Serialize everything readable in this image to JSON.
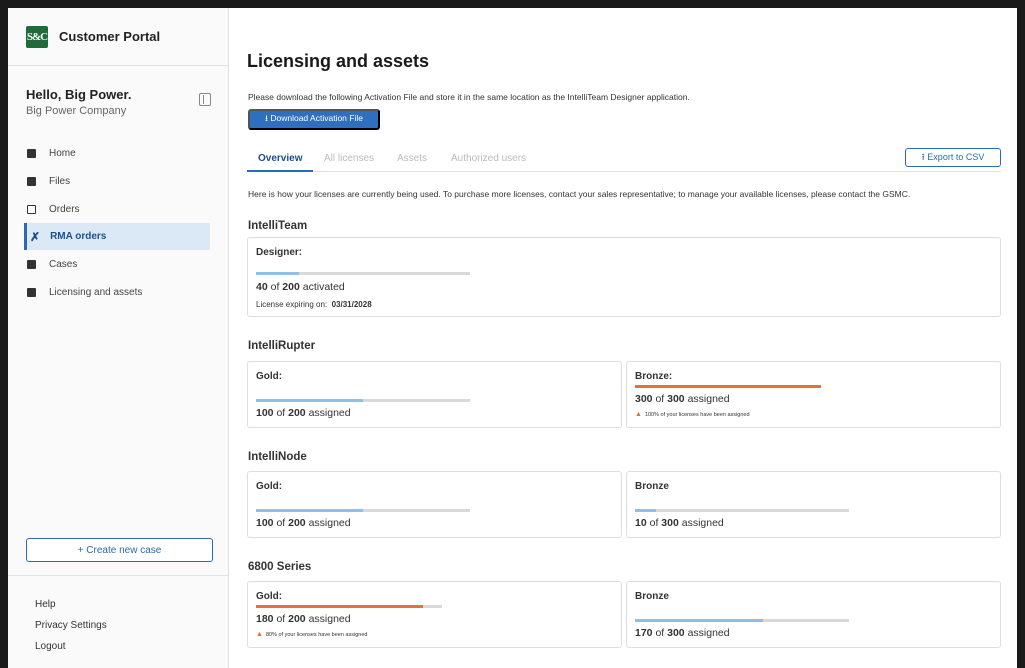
{
  "brand": {
    "logo_text": "S&C",
    "title": "Customer Portal"
  },
  "user": {
    "greeting": "Hello, Big Power.",
    "company": "Big Power Company"
  },
  "nav": [
    {
      "label": "Home",
      "icon": "grid-icon",
      "active": false
    },
    {
      "label": "Files",
      "icon": "folder-icon",
      "active": false
    },
    {
      "label": "Orders",
      "icon": "clipboard-icon",
      "active": false
    },
    {
      "label": "RMA orders",
      "icon": "tools-icon",
      "active": true
    },
    {
      "label": "Cases",
      "icon": "briefcase-icon",
      "active": false
    },
    {
      "label": "Licensing and assets",
      "icon": "card-icon",
      "active": false
    }
  ],
  "create_case": "+ Create new case",
  "footer": [
    "Help",
    "Privacy Settings",
    "Logout"
  ],
  "main": {
    "title": "Licensing and assets",
    "instruction": "Please download the following Activation File and store it in the same location as the IntelliTeam Designer application.",
    "download_button": "⭳ Download Activation File",
    "tabs": [
      "Overview",
      "All licenses",
      "Assets",
      "Authorized users"
    ],
    "export_button": "⭱ Export to CSV",
    "intro": "Here is how your licenses are currently being used. To purchase more licenses, contact your sales representative; to manage your available licenses, please contact the GSMC."
  },
  "colors": {
    "accent": "#2b6cb0",
    "bar_blue": "#8fbfe6",
    "bar_orange": "#e0733a",
    "bar_track": "#d9d9d9"
  },
  "sections": {
    "intelliteam": {
      "title": "IntelliTeam",
      "designer": {
        "name": "Designer:",
        "used": "40",
        "total": "200",
        "word": "activated",
        "fill": 0.2,
        "expiry_label": "License expiring on:",
        "expiry_date": "03/31/2028"
      }
    },
    "intellirupter": {
      "title": "IntelliRupter",
      "gold": {
        "name": "Gold:",
        "used": "100",
        "total": "200",
        "word": "assigned",
        "fill": 0.5
      },
      "bronze": {
        "name": "Bronze:",
        "used": "300",
        "total": "300",
        "word": "assigned",
        "fill": 1.0,
        "warning": "100% of your licenses have been assigned"
      }
    },
    "intellinode": {
      "title": "IntelliNode",
      "gold": {
        "name": "Gold:",
        "used": "100",
        "total": "200",
        "word": "assigned",
        "fill": 0.5
      },
      "bronze": {
        "name": "Bronze",
        "used": "10",
        "total": "300",
        "word": "assigned",
        "fill": 0.1
      }
    },
    "series6800": {
      "title": "6800 Series",
      "gold": {
        "name": "Gold:",
        "used": "180",
        "total": "200",
        "word": "assigned",
        "fill": 0.9,
        "warning": "80% of your licenses have been assigned"
      },
      "bronze": {
        "name": "Bronze",
        "used": "170",
        "total": "300",
        "word": "assigned",
        "fill": 0.6
      }
    }
  }
}
